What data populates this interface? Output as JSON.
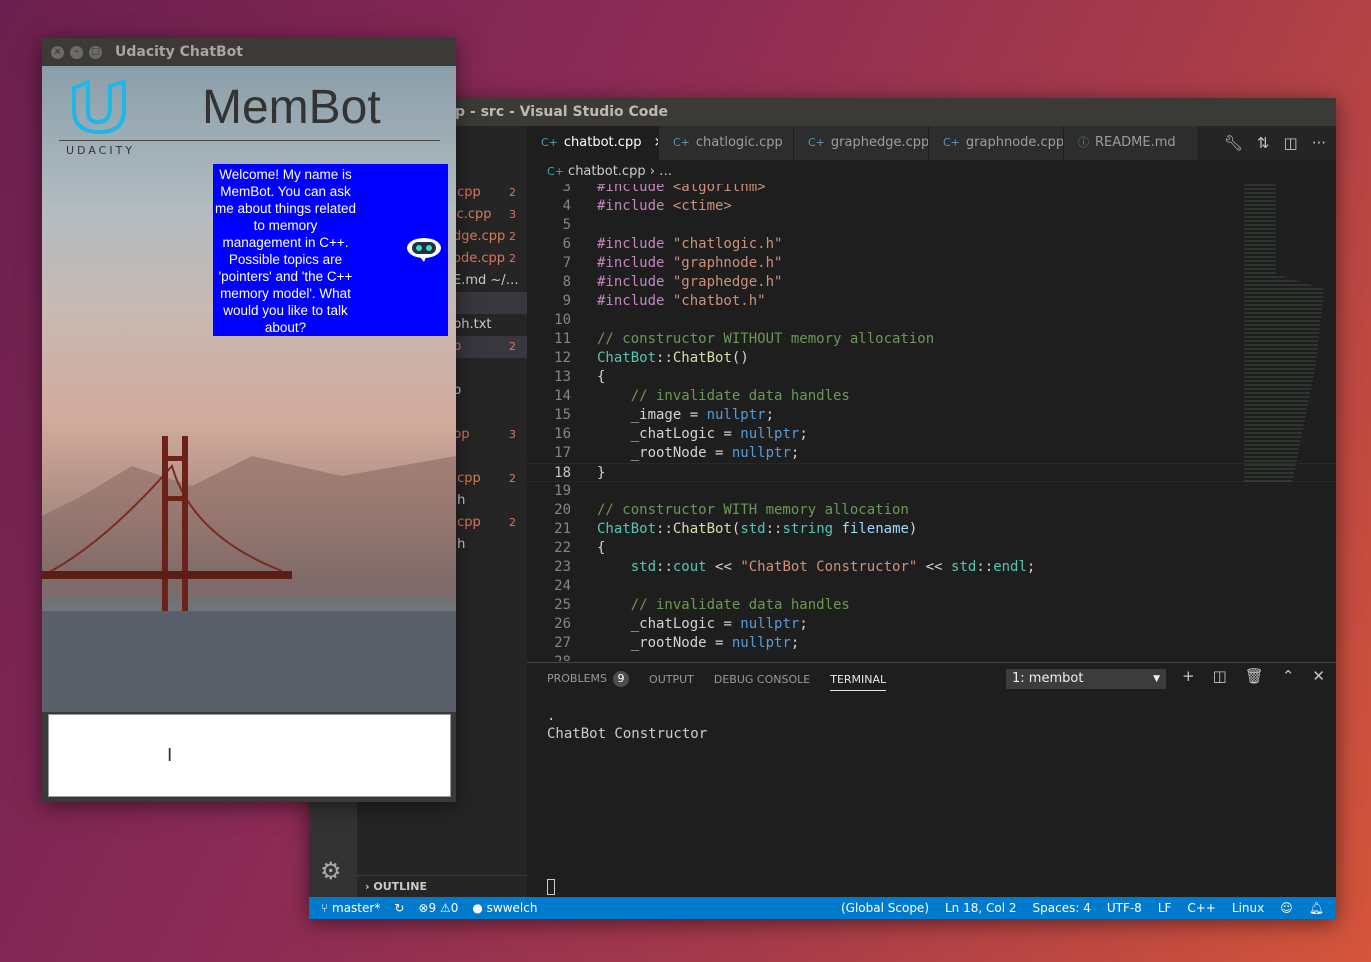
{
  "vscode": {
    "title": "p - src - Visual Studio Code",
    "tabs": [
      {
        "label": "chatbot.cpp",
        "icon": "cpp-icon",
        "active": true
      },
      {
        "label": "chatlogic.cpp",
        "icon": "cpp-icon"
      },
      {
        "label": "graphedge.cpp",
        "icon": "cpp-icon"
      },
      {
        "label": "graphnode.cpp",
        "icon": "cpp-icon"
      },
      {
        "label": "README.md",
        "icon": "info-icon"
      }
    ],
    "close_glyph": "×",
    "breadcrumb": {
      "file": "chatbot.cpp",
      "rest": "› …"
    },
    "sidebar_items": [
      {
        "label": ".cpp",
        "badge": "2",
        "err": true
      },
      {
        "label": "ic.cpp",
        "badge": "3",
        "err": true
      },
      {
        "label": "dge.cpp",
        "badge": "2",
        "err": true
      },
      {
        "label": "ode.cpp",
        "badge": "2",
        "err": true
      },
      {
        "label": "E.md  ~/…",
        "badge": "",
        "err": false
      },
      {
        "label": "",
        "badge": "",
        "err": false,
        "hl": true
      },
      {
        "label": "ph.txt",
        "badge": "",
        "err": false
      },
      {
        "label": "p",
        "badge": "2",
        "err": true,
        "hl": true
      },
      {
        "label": "",
        "badge": "",
        "err": false
      },
      {
        "label": "p",
        "badge": "",
        "err": false
      },
      {
        "label": "",
        "badge": "",
        "err": false
      },
      {
        "label": "pp",
        "badge": "3",
        "err": true
      },
      {
        "label": "",
        "badge": "",
        "err": false
      },
      {
        "label": ".cpp",
        "badge": "2",
        "err": true
      },
      {
        "label": ".h",
        "badge": "",
        "err": false
      },
      {
        "label": ".cpp",
        "badge": "2",
        "err": true
      },
      {
        "label": ".h",
        "badge": "",
        "err": false
      }
    ],
    "outline_label": "OUTLINE",
    "current_line": 18,
    "code": [
      {
        "n": 3,
        "t": [
          [
            "#include ",
            "k"
          ],
          [
            "<algorithm>",
            "s"
          ]
        ]
      },
      {
        "n": 4,
        "t": [
          [
            "#include ",
            "k"
          ],
          [
            "<ctime>",
            "s"
          ]
        ]
      },
      {
        "n": 5,
        "t": []
      },
      {
        "n": 6,
        "t": [
          [
            "#include ",
            "k"
          ],
          [
            "\"chatlogic.h\"",
            "s"
          ]
        ]
      },
      {
        "n": 7,
        "t": [
          [
            "#include ",
            "k"
          ],
          [
            "\"graphnode.h\"",
            "s"
          ]
        ]
      },
      {
        "n": 8,
        "t": [
          [
            "#include ",
            "k"
          ],
          [
            "\"graphedge.h\"",
            "s"
          ]
        ]
      },
      {
        "n": 9,
        "t": [
          [
            "#include ",
            "k"
          ],
          [
            "\"chatbot.h\"",
            "s"
          ]
        ]
      },
      {
        "n": 10,
        "t": []
      },
      {
        "n": 11,
        "t": [
          [
            "// constructor WITHOUT memory allocation",
            "c"
          ]
        ]
      },
      {
        "n": 12,
        "t": [
          [
            "ChatBot",
            "t"
          ],
          [
            "::",
            "p"
          ],
          [
            "ChatBot",
            "f"
          ],
          [
            "()",
            "p"
          ]
        ]
      },
      {
        "n": 13,
        "t": [
          [
            "{",
            "p"
          ]
        ]
      },
      {
        "n": 14,
        "t": [
          [
            "    // invalidate data handles",
            "c"
          ]
        ]
      },
      {
        "n": 15,
        "t": [
          [
            "    _image ",
            "p"
          ],
          [
            "= ",
            "p"
          ],
          [
            "nullptr",
            "b"
          ],
          [
            ";",
            "p"
          ]
        ]
      },
      {
        "n": 16,
        "t": [
          [
            "    _chatLogic ",
            "p"
          ],
          [
            "= ",
            "p"
          ],
          [
            "nullptr",
            "b"
          ],
          [
            ";",
            "p"
          ]
        ]
      },
      {
        "n": 17,
        "t": [
          [
            "    _rootNode ",
            "p"
          ],
          [
            "= ",
            "p"
          ],
          [
            "nullptr",
            "b"
          ],
          [
            ";",
            "p"
          ]
        ]
      },
      {
        "n": 18,
        "t": [
          [
            "}",
            "p"
          ]
        ]
      },
      {
        "n": 19,
        "t": []
      },
      {
        "n": 20,
        "t": [
          [
            "// constructor WITH memory allocation",
            "c"
          ]
        ]
      },
      {
        "n": 21,
        "t": [
          [
            "ChatBot",
            "t"
          ],
          [
            "::",
            "p"
          ],
          [
            "ChatBot",
            "f"
          ],
          [
            "(",
            "p"
          ],
          [
            "std",
            "t"
          ],
          [
            "::",
            "p"
          ],
          [
            "string",
            "t"
          ],
          [
            " filename",
            "v"
          ],
          [
            ")",
            "p"
          ]
        ]
      },
      {
        "n": 22,
        "t": [
          [
            "{",
            "p"
          ]
        ]
      },
      {
        "n": 23,
        "t": [
          [
            "    std",
            "t"
          ],
          [
            "::",
            "p"
          ],
          [
            "cout",
            "t"
          ],
          [
            " << ",
            "p"
          ],
          [
            "\"ChatBot Constructor\"",
            "s"
          ],
          [
            " << ",
            "p"
          ],
          [
            "std",
            "t"
          ],
          [
            "::",
            "p"
          ],
          [
            "endl",
            "t"
          ],
          [
            ";",
            "p"
          ]
        ]
      },
      {
        "n": 24,
        "t": []
      },
      {
        "n": 25,
        "t": [
          [
            "    // invalidate data handles",
            "c"
          ]
        ]
      },
      {
        "n": 26,
        "t": [
          [
            "    _chatLogic ",
            "p"
          ],
          [
            "= ",
            "p"
          ],
          [
            "nullptr",
            "b"
          ],
          [
            ";",
            "p"
          ]
        ]
      },
      {
        "n": 27,
        "t": [
          [
            "    _rootNode ",
            "p"
          ],
          [
            "= ",
            "p"
          ],
          [
            "nullptr",
            "b"
          ],
          [
            ";",
            "p"
          ]
        ]
      },
      {
        "n": 28,
        "t": []
      }
    ],
    "panel": {
      "tabs": [
        "PROBLEMS",
        "OUTPUT",
        "DEBUG CONSOLE",
        "TERMINAL"
      ],
      "problems_count": "9",
      "active_tab": "TERMINAL",
      "terminal_select": "1: membot",
      "terminal_output": ".\nChatBot Constructor"
    },
    "status": {
      "branch": "master*",
      "errors": "9",
      "warnings": "0",
      "github_user": "swwelch",
      "scope": "(Global Scope)",
      "position": "Ln 18, Col 2",
      "spaces": "Spaces: 4",
      "encoding": "UTF-8",
      "eol": "LF",
      "language": "C++",
      "os": "Linux"
    },
    "colors": {
      "statusbar": "#007acc",
      "bubble": "#0000ff"
    }
  },
  "chatbot": {
    "title": "Udacity ChatBot",
    "logo_text": "UDACITY",
    "app_name": "MemBot",
    "message": "Welcome! My name is MemBot. You can ask me about things related to memory management in C++. Possible topics are 'pointers' and 'the C++ memory model'. What would you like to talk about?",
    "input_value": ""
  }
}
